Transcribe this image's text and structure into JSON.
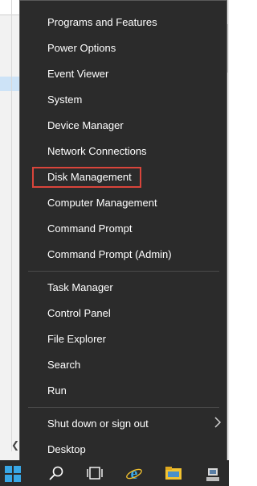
{
  "menu": {
    "items": [
      {
        "label": "Programs and Features"
      },
      {
        "label": "Power Options"
      },
      {
        "label": "Event Viewer"
      },
      {
        "label": "System"
      },
      {
        "label": "Device Manager"
      },
      {
        "label": "Network Connections"
      },
      {
        "label": "Disk Management"
      },
      {
        "label": "Computer Management"
      },
      {
        "label": "Command Prompt"
      },
      {
        "label": "Command Prompt (Admin)"
      },
      {
        "label": "Task Manager"
      },
      {
        "label": "Control Panel"
      },
      {
        "label": "File Explorer"
      },
      {
        "label": "Search"
      },
      {
        "label": "Run"
      },
      {
        "label": "Shut down or sign out"
      },
      {
        "label": "Desktop"
      }
    ],
    "highlight_color": "#d9453b",
    "background": "#2b2b2b"
  },
  "taskbar": {
    "icons": [
      "windows-start-icon",
      "search-icon",
      "task-view-icon",
      "internet-explorer-icon",
      "file-explorer-icon",
      "network-icon"
    ],
    "accent": "#38a7e6"
  }
}
